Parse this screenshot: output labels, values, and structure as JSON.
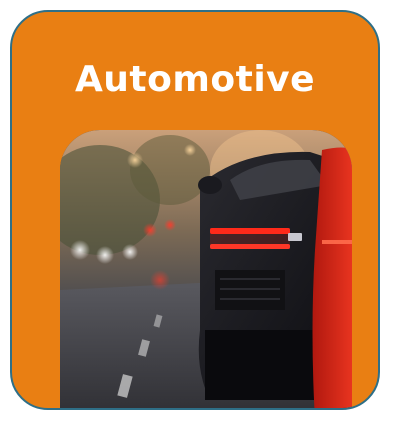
{
  "card": {
    "title": "Automotive",
    "accent_color": "#e97f13",
    "border_color": "#2e6f87",
    "image_semantic": "sports-car-rear-view-photo"
  }
}
